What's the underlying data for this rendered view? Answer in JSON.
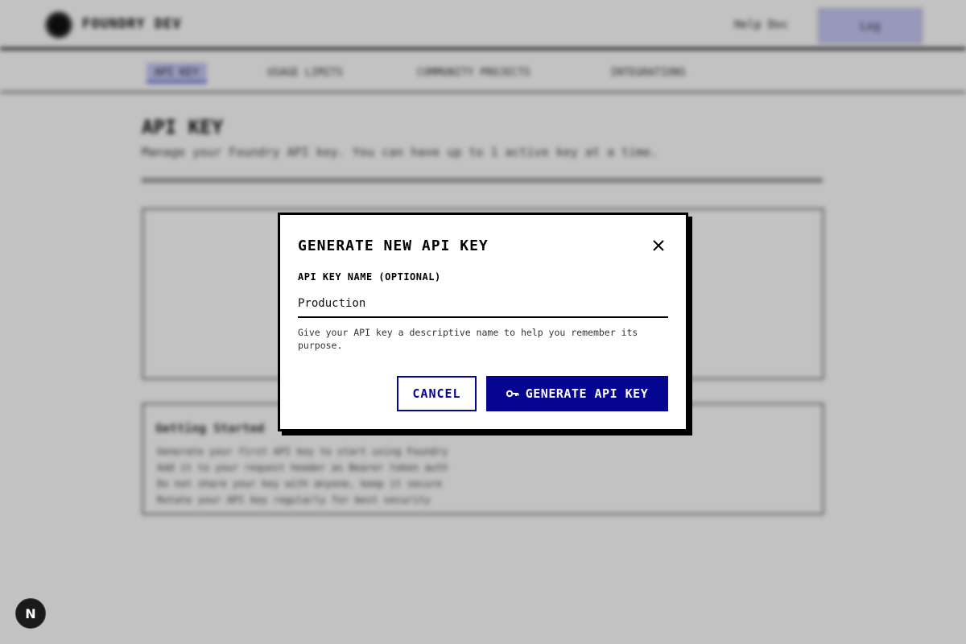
{
  "background": {
    "brand": "FOUNDRY DEV",
    "help_label": "Help Doc",
    "top_button": "Log",
    "tabs": [
      {
        "label": "API KEY"
      },
      {
        "label": "USAGE LIMITS"
      },
      {
        "label": "COMMUNITY PROJECTS"
      },
      {
        "label": "INTEGRATIONS"
      }
    ],
    "page_title": "API KEY",
    "page_subtitle": "Manage your Foundry API key. You can have up to 1 active key at a time.",
    "card_title": "Getting Started",
    "card_items": [
      "Generate your first API key to start using Foundry",
      "Add it to your request header as Bearer token auth",
      "Do not share your key with anyone, keep it secure",
      "Rotate your API key regularly for best security"
    ]
  },
  "modal": {
    "title": "GENERATE NEW API KEY",
    "field_label": "API KEY NAME (OPTIONAL)",
    "input_value": "Production",
    "hint": "Give your API key a descriptive name to help you remember its purpose.",
    "cancel_label": "CANCEL",
    "generate_label": "GENERATE API KEY",
    "close_icon": "close-icon",
    "key_icon": "key-icon"
  },
  "badge": {
    "label": "N"
  },
  "colors": {
    "primary": "#050592",
    "overlay": "rgba(0,0,0,0.24)"
  }
}
